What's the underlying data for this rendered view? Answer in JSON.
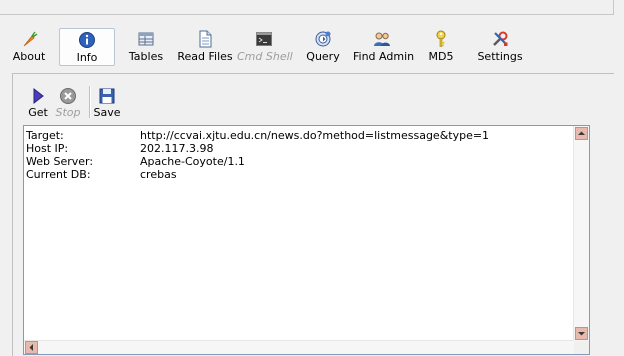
{
  "toolbar": {
    "buttons": [
      {
        "label": "About",
        "icon": "carrot-icon"
      },
      {
        "label": "Info",
        "icon": "info-icon"
      },
      {
        "label": "Tables",
        "icon": "table-icon"
      },
      {
        "label": "Read Files",
        "icon": "document-icon"
      },
      {
        "label": "Cmd Shell",
        "icon": "terminal-icon"
      },
      {
        "label": "Query",
        "icon": "query-icon"
      },
      {
        "label": "Find Admin",
        "icon": "users-icon"
      },
      {
        "label": "MD5",
        "icon": "key-icon"
      },
      {
        "label": "Settings",
        "icon": "tools-icon"
      }
    ],
    "active": "Info",
    "disabled": [
      "Cmd Shell"
    ]
  },
  "subtoolbar": {
    "get_label": "Get",
    "stop_label": "Stop",
    "save_label": "Save"
  },
  "info": [
    {
      "key": "Target:",
      "value": "http://ccvai.xjtu.edu.cn/news.do?method=listmessage&type=1"
    },
    {
      "key": "Host IP:",
      "value": "202.117.3.98"
    },
    {
      "key": "Web Server:",
      "value": "Apache-Coyote/1.1"
    },
    {
      "key": "Current DB:",
      "value": "crebas"
    }
  ],
  "colors": {
    "accent": "#3a6ea5",
    "scroll_arrow_bg": "#e8b9ad",
    "disabled_text": "#9d9d9d"
  }
}
